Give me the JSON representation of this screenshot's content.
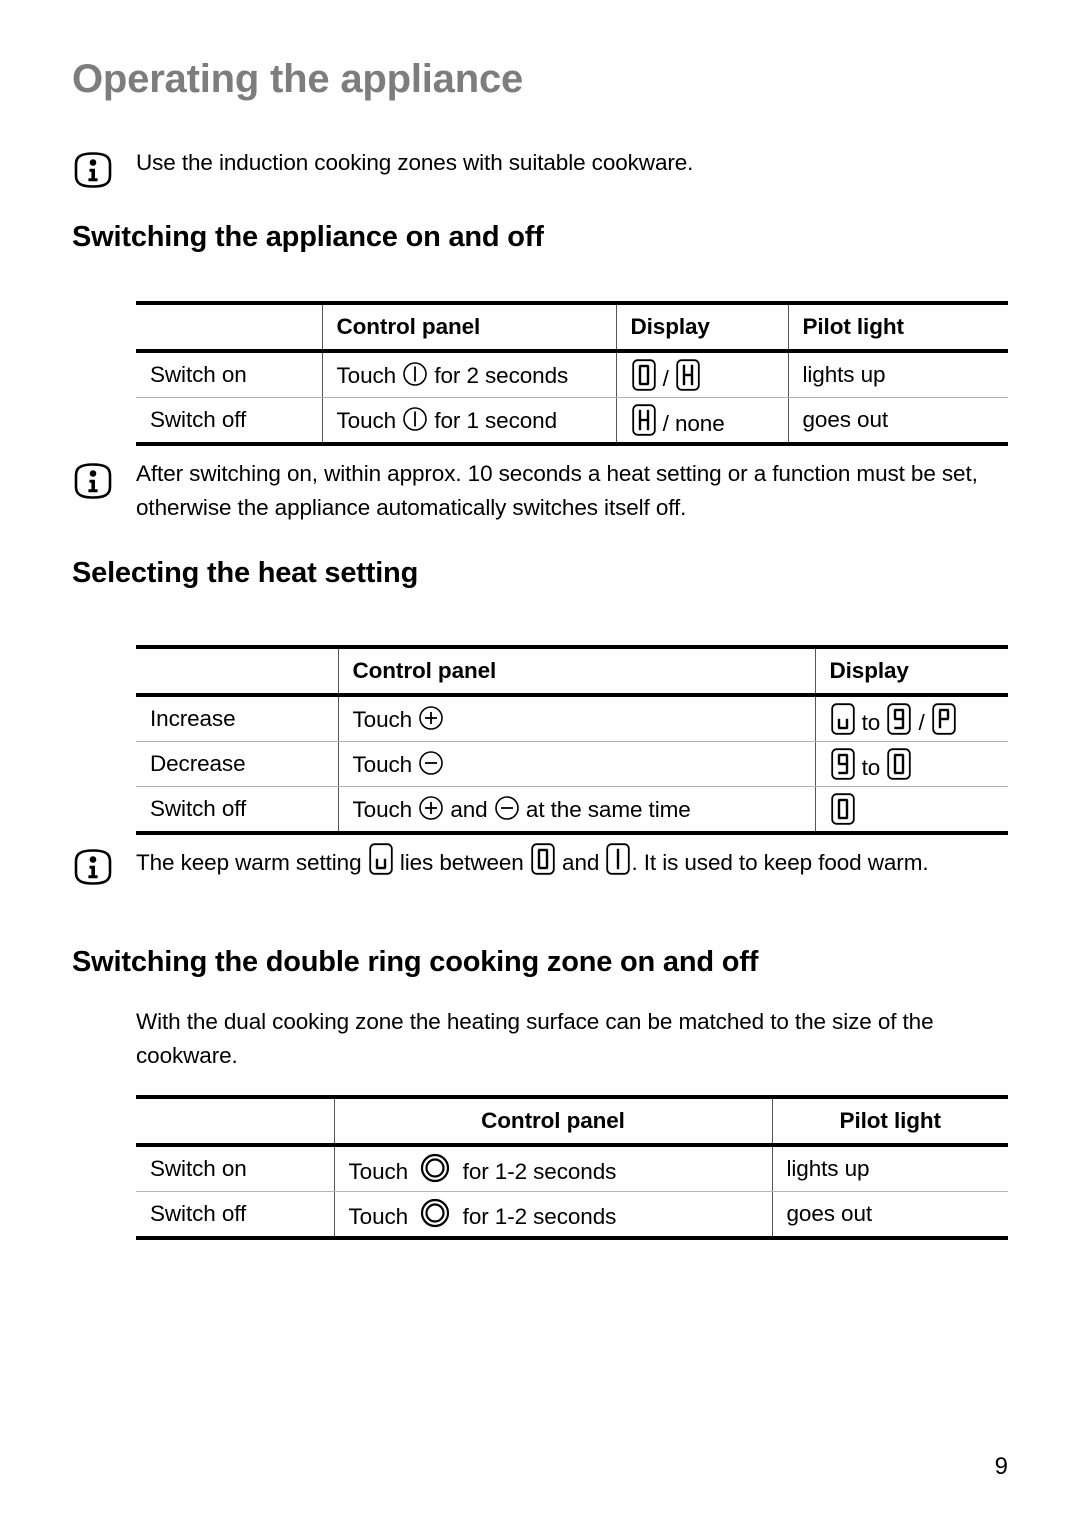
{
  "page": {
    "title": "Operating the appliance",
    "number": "9",
    "title_color": "#7d7d7d"
  },
  "notes": {
    "cookware": "Use the induction cooking zones with suitable cookware.",
    "auto_switch_off": "After switching on, within approx. 10 seconds a heat setting or a function must be set, otherwise the appliance automatically switches itself off.",
    "keep_warm": {
      "part1": "The keep warm setting",
      "glyph1": "u",
      "part2": "lies between",
      "glyph2": "0",
      "part3": "and",
      "glyph3": "1",
      "part4": ". It is used to keep food warm."
    }
  },
  "sections": {
    "switching_on_off": {
      "heading": "Switching the appliance on and off",
      "table": {
        "headers": [
          "",
          "Control panel",
          "Display",
          "Pilot light"
        ],
        "rows": [
          {
            "label": "Switch on",
            "control_pre": "Touch",
            "control_icon": "power-icon",
            "control_post": "for 2 seconds",
            "display_a": "0",
            "display_sep": "/",
            "display_b": "H",
            "pilot": "lights up"
          },
          {
            "label": "Switch off",
            "control_pre": "Touch",
            "control_icon": "power-icon",
            "control_post": "for 1 second",
            "display_a": "H",
            "display_sep": "/ none",
            "display_b": "",
            "pilot": "goes out"
          }
        ]
      }
    },
    "heat_setting": {
      "heading": "Selecting the heat setting",
      "table": {
        "headers": [
          "",
          "Control panel",
          "Display"
        ],
        "rows": [
          {
            "label": "Increase",
            "control_pre": "Touch",
            "control_icon": "plus-circle-icon",
            "control_mid": "",
            "control_icon2": "",
            "control_post": "",
            "display_a": "u",
            "display_mid": "to",
            "display_b": "9",
            "display_sep": "/",
            "display_c": "P"
          },
          {
            "label": "Decrease",
            "control_pre": "Touch",
            "control_icon": "minus-circle-icon",
            "control_mid": "",
            "control_icon2": "",
            "control_post": "",
            "display_a": "9",
            "display_mid": "to",
            "display_b": "0",
            "display_sep": "",
            "display_c": ""
          },
          {
            "label": "Switch off",
            "control_pre": "Touch",
            "control_icon": "plus-circle-icon",
            "control_mid": "and",
            "control_icon2": "minus-circle-icon",
            "control_post": "at the same time",
            "display_a": "0",
            "display_mid": "",
            "display_b": "",
            "display_sep": "",
            "display_c": ""
          }
        ]
      }
    },
    "double_ring": {
      "heading": "Switching the double ring cooking zone on and off",
      "paragraph": "With the dual cooking zone the heating surface can be matched to the size of the cookware.",
      "table": {
        "headers": [
          "",
          "Control panel",
          "Pilot light"
        ],
        "rows": [
          {
            "label": "Switch on",
            "control_pre": "Touch",
            "control_icon": "double-ring-icon",
            "control_post": "for 1-2 seconds",
            "pilot": "lights up"
          },
          {
            "label": "Switch off",
            "control_pre": "Touch",
            "control_icon": "double-ring-icon",
            "control_post": "for 1-2 seconds",
            "pilot": "goes out"
          }
        ]
      }
    }
  }
}
